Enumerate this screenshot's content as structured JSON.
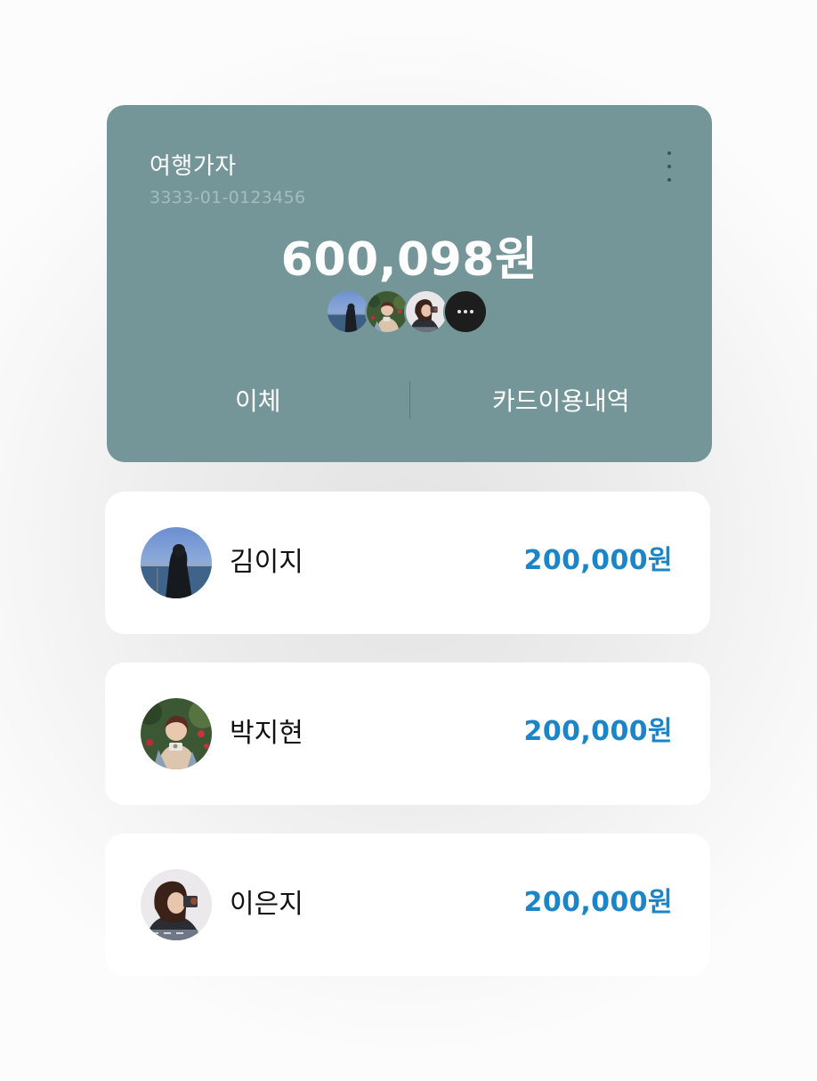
{
  "account": {
    "name": "여행가자",
    "number": "3333-01-0123456",
    "balance": "600,098원",
    "members_icon": "group-avatars",
    "more_icon": "more-vertical-icon"
  },
  "actions": {
    "transfer_label": "이체",
    "card_history_label": "카드이용내역"
  },
  "members": [
    {
      "name": "김이지",
      "amount": "200,000원",
      "avatar_icon": "profile-photo"
    },
    {
      "name": "박지현",
      "amount": "200,000원",
      "avatar_icon": "profile-photo"
    },
    {
      "name": "이은지",
      "amount": "200,000원",
      "avatar_icon": "profile-photo"
    }
  ],
  "colors": {
    "card_background": "#759699",
    "amount_accent": "#1a85c8"
  }
}
